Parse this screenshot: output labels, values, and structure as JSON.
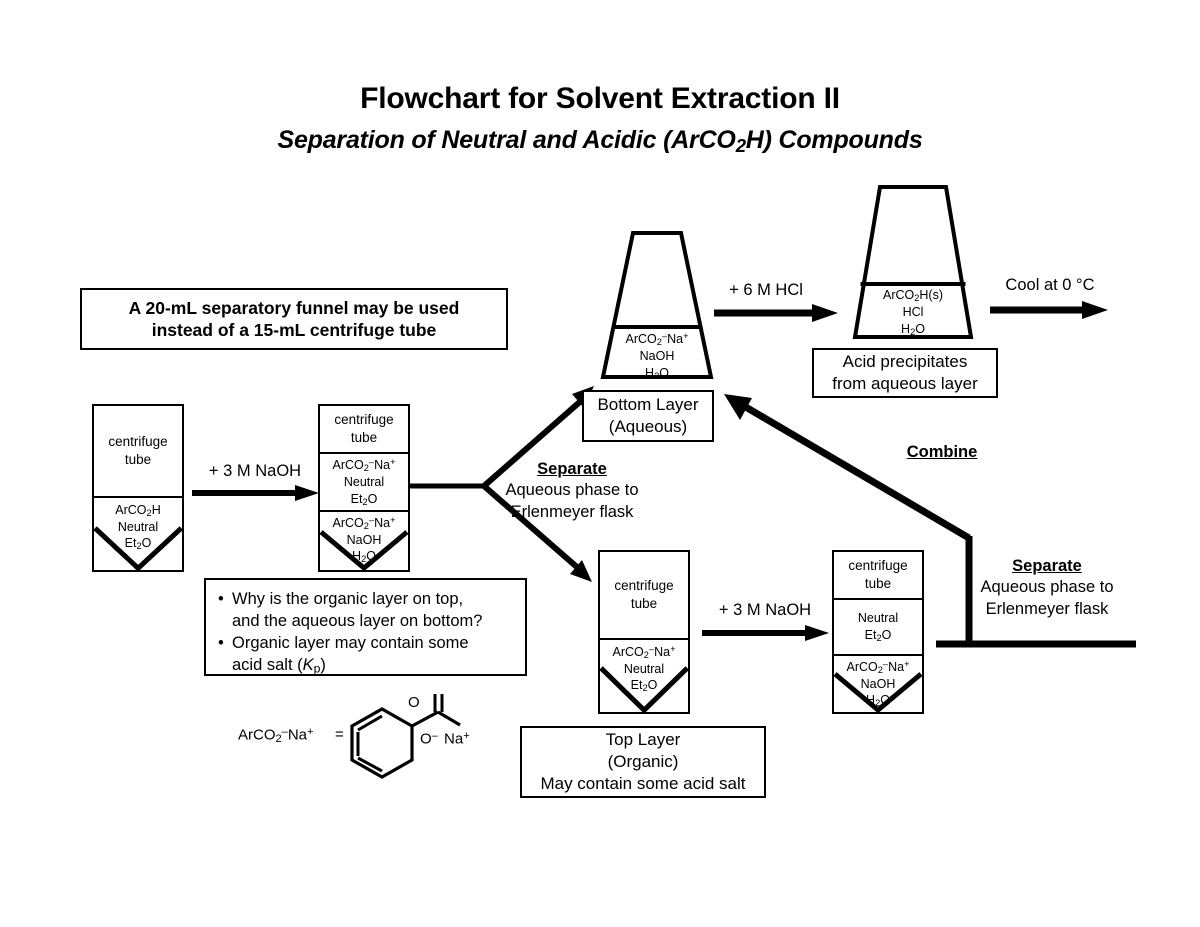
{
  "title": {
    "main": "Flowchart for Solvent Extraction II",
    "sub_prefix": "Separation of Neutral and Acidic (ArCO",
    "sub_sub": "2",
    "sub_suffix": "H) Compounds"
  },
  "note_box": {
    "line1": "A 20-mL separatory funnel may be used",
    "line2": "instead of a 15-mL centrifuge tube"
  },
  "tube1": {
    "head": {
      "l1": "centrifuge",
      "l2": "tube"
    },
    "bottom": {
      "l1_a": "ArCO",
      "l1_sub": "2",
      "l1_b": "H",
      "l2": "Neutral",
      "l3_a": "Et",
      "l3_sub": "2",
      "l3_b": "O"
    }
  },
  "tube2": {
    "head": {
      "l1": "centrifuge",
      "l2": "tube"
    },
    "middle": {
      "l1_a": "ArCO",
      "l1_sub": "2",
      "l1_minus": "–",
      "l1_na": "Na",
      "l1_plus": "+",
      "l2": "Neutral",
      "l3_a": "Et",
      "l3_sub": "2",
      "l3_b": "O"
    },
    "bottom": {
      "l1_a": "ArCO",
      "l1_sub": "2",
      "l1_minus": "–",
      "l1_na": "Na",
      "l1_plus": "+",
      "l2": "NaOH",
      "l3_a": "H",
      "l3_sub": "2",
      "l3_b": "O"
    }
  },
  "funnel_top": {
    "l1_a": "ArCO",
    "l1_sub": "2",
    "l1_minus": "–",
    "l1_na": "Na",
    "l1_plus": "+",
    "l2": "NaOH",
    "l3_a": "H",
    "l3_sub": "2",
    "l3_b": "O"
  },
  "funnel_right": {
    "l1_a": "ArCO",
    "l1_sub": "2",
    "l1_b": "H(s)",
    "l2": "HCl",
    "l3_a": "H",
    "l3_sub": "2",
    "l3_b": "O"
  },
  "tube3": {
    "head": {
      "l1": "centrifuge",
      "l2": "tube"
    },
    "bottom": {
      "l1_a": "ArCO",
      "l1_sub": "2",
      "l1_minus": "–",
      "l1_na": "Na",
      "l1_plus": "+",
      "l2": "Neutral",
      "l3_a": "Et",
      "l3_sub": "2",
      "l3_b": "O"
    }
  },
  "tube4": {
    "head": {
      "l1": "centrifuge",
      "l2": "tube"
    },
    "middle": {
      "l1": "Neutral",
      "l2_a": "Et",
      "l2_sub": "2",
      "l2_b": "O"
    },
    "bottom": {
      "l1_a": "ArCO",
      "l1_sub": "2",
      "l1_minus": "–",
      "l1_na": "Na",
      "l1_plus": "+",
      "l2": "NaOH",
      "l3_a": "H",
      "l3_sub": "2",
      "l3_b": "O"
    }
  },
  "arrows": {
    "naoh_1": "+  3 M NaOH",
    "hcl": "+  6 M HCl",
    "cool": "Cool at 0 °C",
    "naoh_2": "+  3 M NaOH"
  },
  "separate_left": {
    "heading": "Separate",
    "line1": "Aqueous phase to",
    "line2": "Erlenmeyer flask"
  },
  "separate_right": {
    "heading": "Separate",
    "line1": "Aqueous phase to",
    "line2": "Erlenmeyer flask"
  },
  "combine": {
    "heading": "Combine"
  },
  "bottom_layer": {
    "l1": "Bottom Layer",
    "l2": "(Aqueous)"
  },
  "top_layer": {
    "l1": "Top Layer",
    "l2": "(Organic)",
    "l3": "May contain some acid salt"
  },
  "acid_precip": {
    "l1": "Acid precipitates",
    "l2": "from aqueous layer"
  },
  "bullets": {
    "marker": "•",
    "b1_l1": "Why is the organic layer on top,",
    "b1_l2": "and the aqueous layer on bottom?",
    "b2_l1": "Organic layer may contain some",
    "b2_l2_pre": "acid salt (",
    "b2_k": "K",
    "b2_k_sub": "p",
    "b2_l2_post": ")"
  },
  "structure": {
    "formula_a": "ArCO",
    "formula_sub": "2",
    "formula_minus": "–",
    "formula_na": "Na",
    "formula_plus": "+",
    "equals": "=",
    "oxygen_top": "O",
    "o_minus_a": "O",
    "o_minus_sup": "–",
    "na_a": "Na",
    "na_sup": "+"
  },
  "colors": {
    "ink": "#000000",
    "paper": "#ffffff"
  }
}
